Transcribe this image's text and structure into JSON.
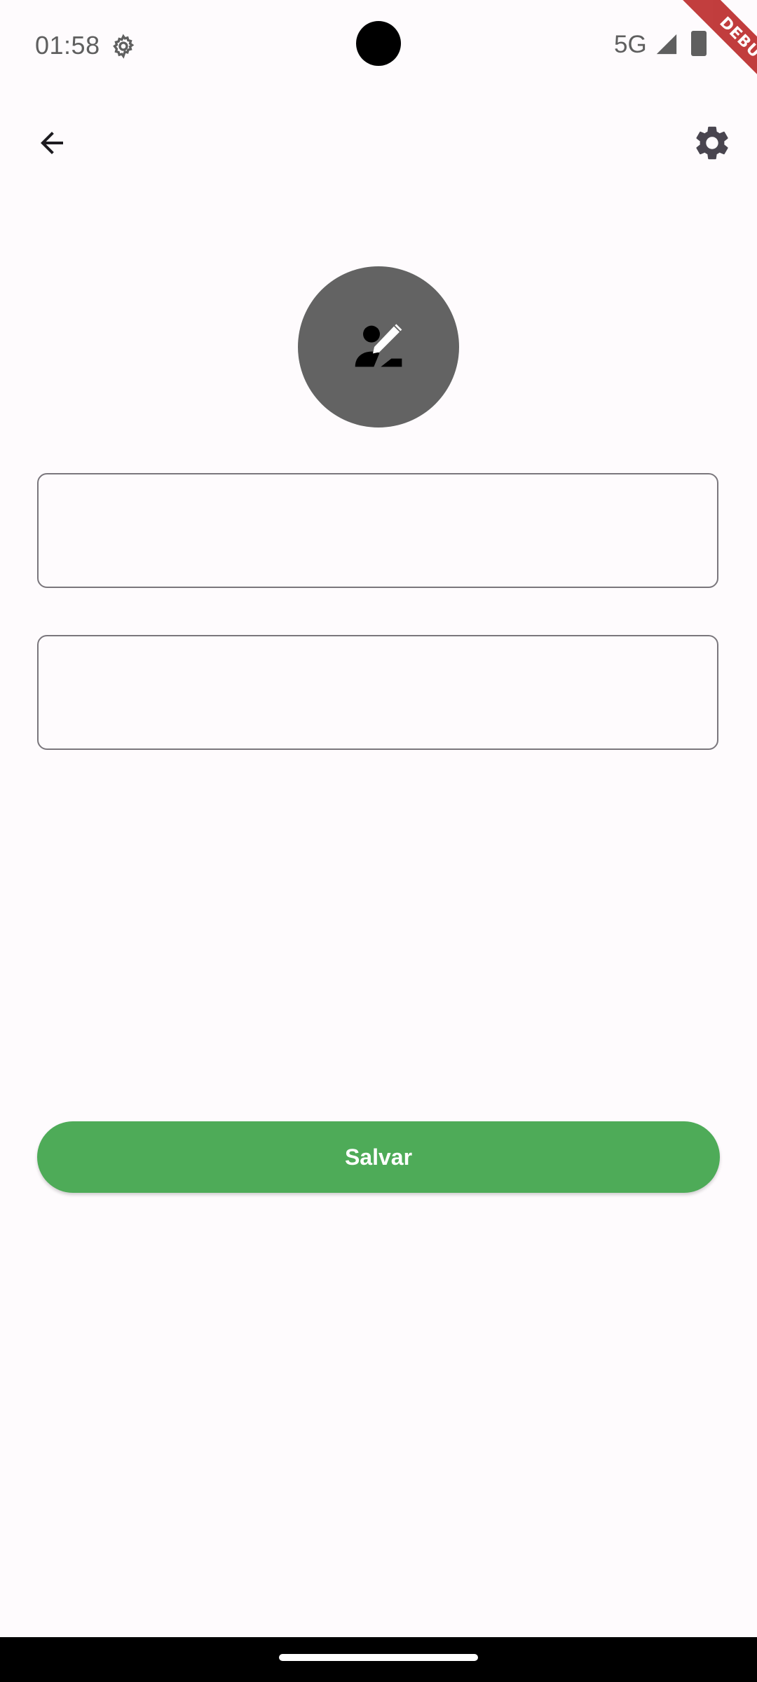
{
  "status_bar": {
    "time": "01:58",
    "network": "5G",
    "icons": [
      "settings-gear-icon",
      "signal-icon",
      "battery-icon"
    ]
  },
  "debug_banner": "DEBUG",
  "app_bar": {
    "back_icon": "arrow-back-icon",
    "settings_icon": "settings-gear-icon"
  },
  "avatar": {
    "icon": "person-edit-icon",
    "background_color": "#636363"
  },
  "form": {
    "name_field": {
      "value": "",
      "placeholder": ""
    },
    "email_field": {
      "value": "",
      "placeholder": ""
    },
    "save_label": "Salvar",
    "save_color": "#4eab58"
  }
}
